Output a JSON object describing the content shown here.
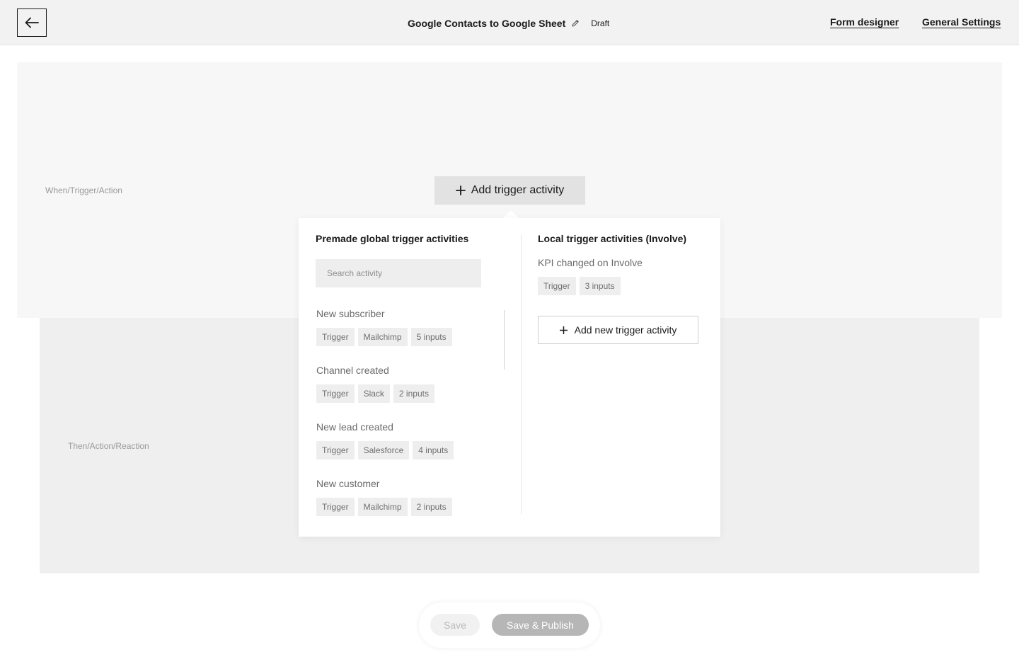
{
  "header": {
    "back_icon": "arrow-left-icon",
    "title": "Google Contacts to Google Sheet",
    "edit_icon": "pencil-icon",
    "status": "Draft",
    "links": [
      "Form designer",
      "General Settings"
    ]
  },
  "canvas": {
    "trigger_label": "When/Trigger/Action",
    "action_label": "Then/Action/Reaction",
    "add_trigger_label": "Add trigger activity",
    "plus_icon": "plus-icon"
  },
  "dropdown": {
    "global": {
      "title": "Premade global trigger activities",
      "search_placeholder": "Search activity",
      "activities": [
        {
          "name": "New subscriber",
          "tags": [
            "Trigger",
            "Mailchimp",
            "5 inputs"
          ]
        },
        {
          "name": "Channel created",
          "tags": [
            "Trigger",
            "Slack",
            "2 inputs"
          ]
        },
        {
          "name": "New lead created",
          "tags": [
            "Trigger",
            "Salesforce",
            "4 inputs"
          ]
        },
        {
          "name": "New customer",
          "tags": [
            "Trigger",
            "Mailchimp",
            "2 inputs"
          ]
        }
      ]
    },
    "local": {
      "title": "Local trigger activities (Involve)",
      "activities": [
        {
          "name": "KPI changed on Involve",
          "tags": [
            "Trigger",
            "3 inputs"
          ]
        }
      ],
      "add_new_label": "Add new trigger activity"
    }
  },
  "footer": {
    "save_label": "Save",
    "publish_label": "Save & Publish"
  },
  "colors": {
    "header_bg": "#f2f2f2",
    "trigger_bg": "#f7f7f7",
    "action_bg": "#efefef",
    "tag_bg": "#eeeeee",
    "publish_bg": "#b6b6b6"
  }
}
